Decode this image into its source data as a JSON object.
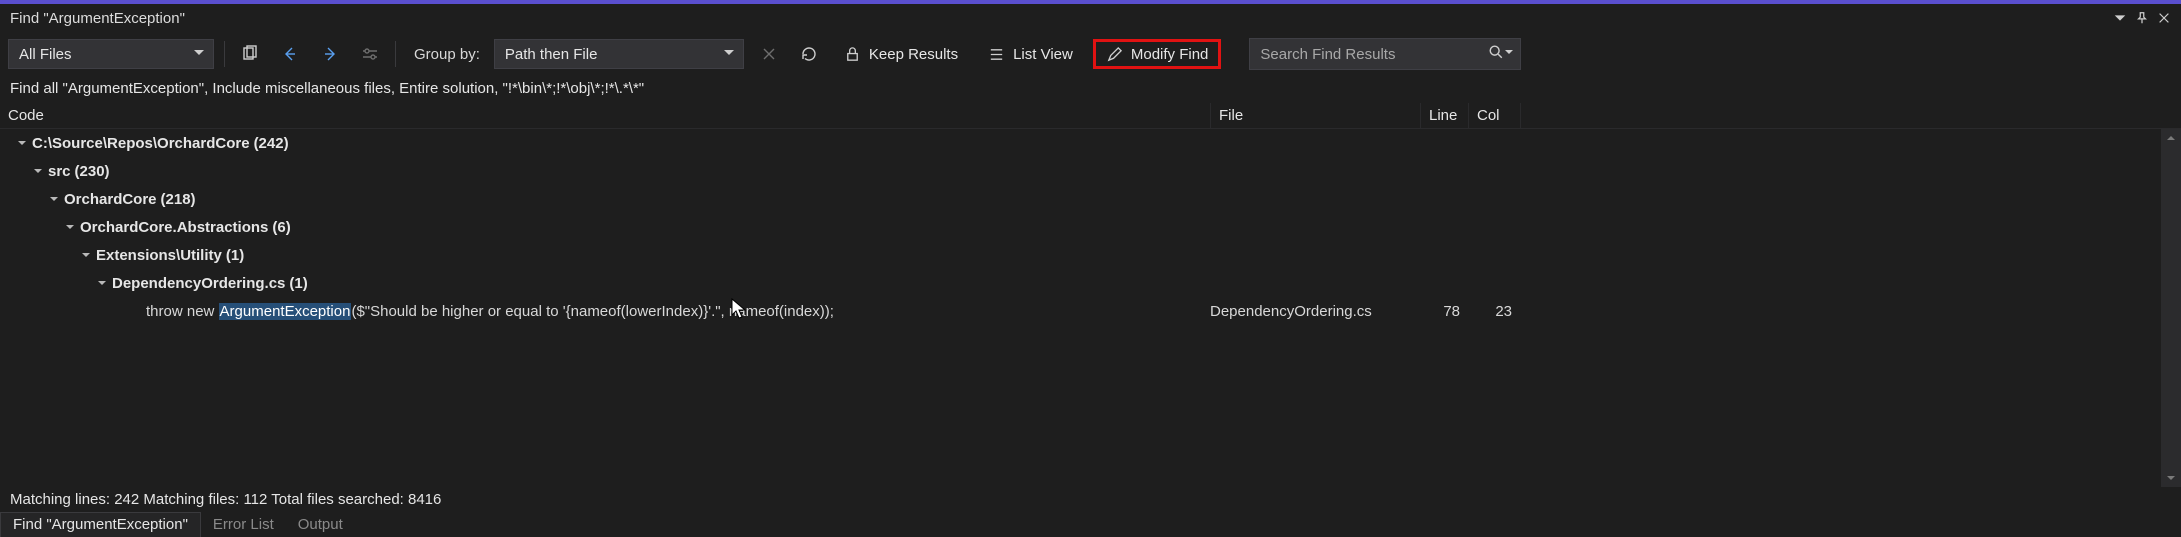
{
  "title": "Find \"ArgumentException\"",
  "toolbar": {
    "scope_selected": "All Files",
    "group_by_label": "Group by:",
    "group_by_selected": "Path then File",
    "keep_results": "Keep Results",
    "list_view": "List View",
    "modify_find": "Modify Find",
    "search_placeholder": "Search Find Results"
  },
  "summary": "Find all \"ArgumentException\", Include miscellaneous files, Entire solution, \"!*\\bin\\*;!*\\obj\\*;!*\\.*\\*\"",
  "columns": {
    "code": "Code",
    "file": "File",
    "line": "Line",
    "col": "Col"
  },
  "tree": [
    {
      "indent": 0,
      "label": "C:\\Source\\Repos\\OrchardCore",
      "count": "(242)"
    },
    {
      "indent": 1,
      "label": "src",
      "count": "(230)"
    },
    {
      "indent": 2,
      "label": "OrchardCore",
      "count": "(218)"
    },
    {
      "indent": 3,
      "label": "OrchardCore.Abstractions",
      "count": "(6)"
    },
    {
      "indent": 4,
      "label": "Extensions\\Utility",
      "count": "(1)"
    },
    {
      "indent": 5,
      "label": "DependencyOrdering.cs",
      "count": "(1)"
    }
  ],
  "result": {
    "pre": "throw new ",
    "match": "ArgumentException",
    "post": "($\"Should be higher or equal to '{nameof(lowerIndex)}'.\", nameof(index));",
    "file": "DependencyOrdering.cs",
    "line": "78",
    "col": "23"
  },
  "status": "Matching lines: 242 Matching files: 112 Total files searched: 8416",
  "tabs": {
    "active": "Find \"ArgumentException\"",
    "error_list": "Error List",
    "output": "Output"
  }
}
